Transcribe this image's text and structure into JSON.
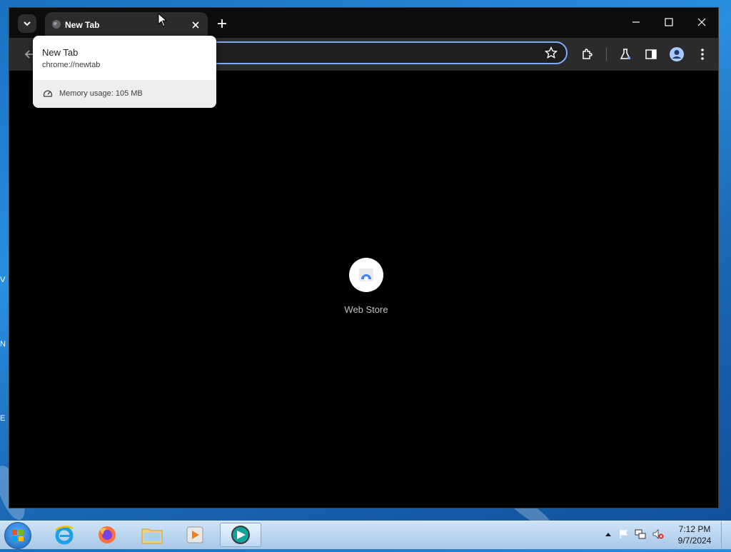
{
  "browser": {
    "tab_title": "New Tab",
    "tooltip": {
      "title": "New Tab",
      "url": "chrome://newtab",
      "memory": "Memory usage: 105 MB"
    },
    "shortcut_label": "Web Store",
    "accent": "#7cacf8"
  },
  "taskbar": {
    "time": "7:12 PM",
    "date": "9/7/2024",
    "apps": [
      "internet-explorer",
      "firefox",
      "file-explorer",
      "media-player",
      "chrome-dev"
    ]
  },
  "desktop": {
    "fragments": [
      "V",
      "N",
      "E"
    ]
  }
}
